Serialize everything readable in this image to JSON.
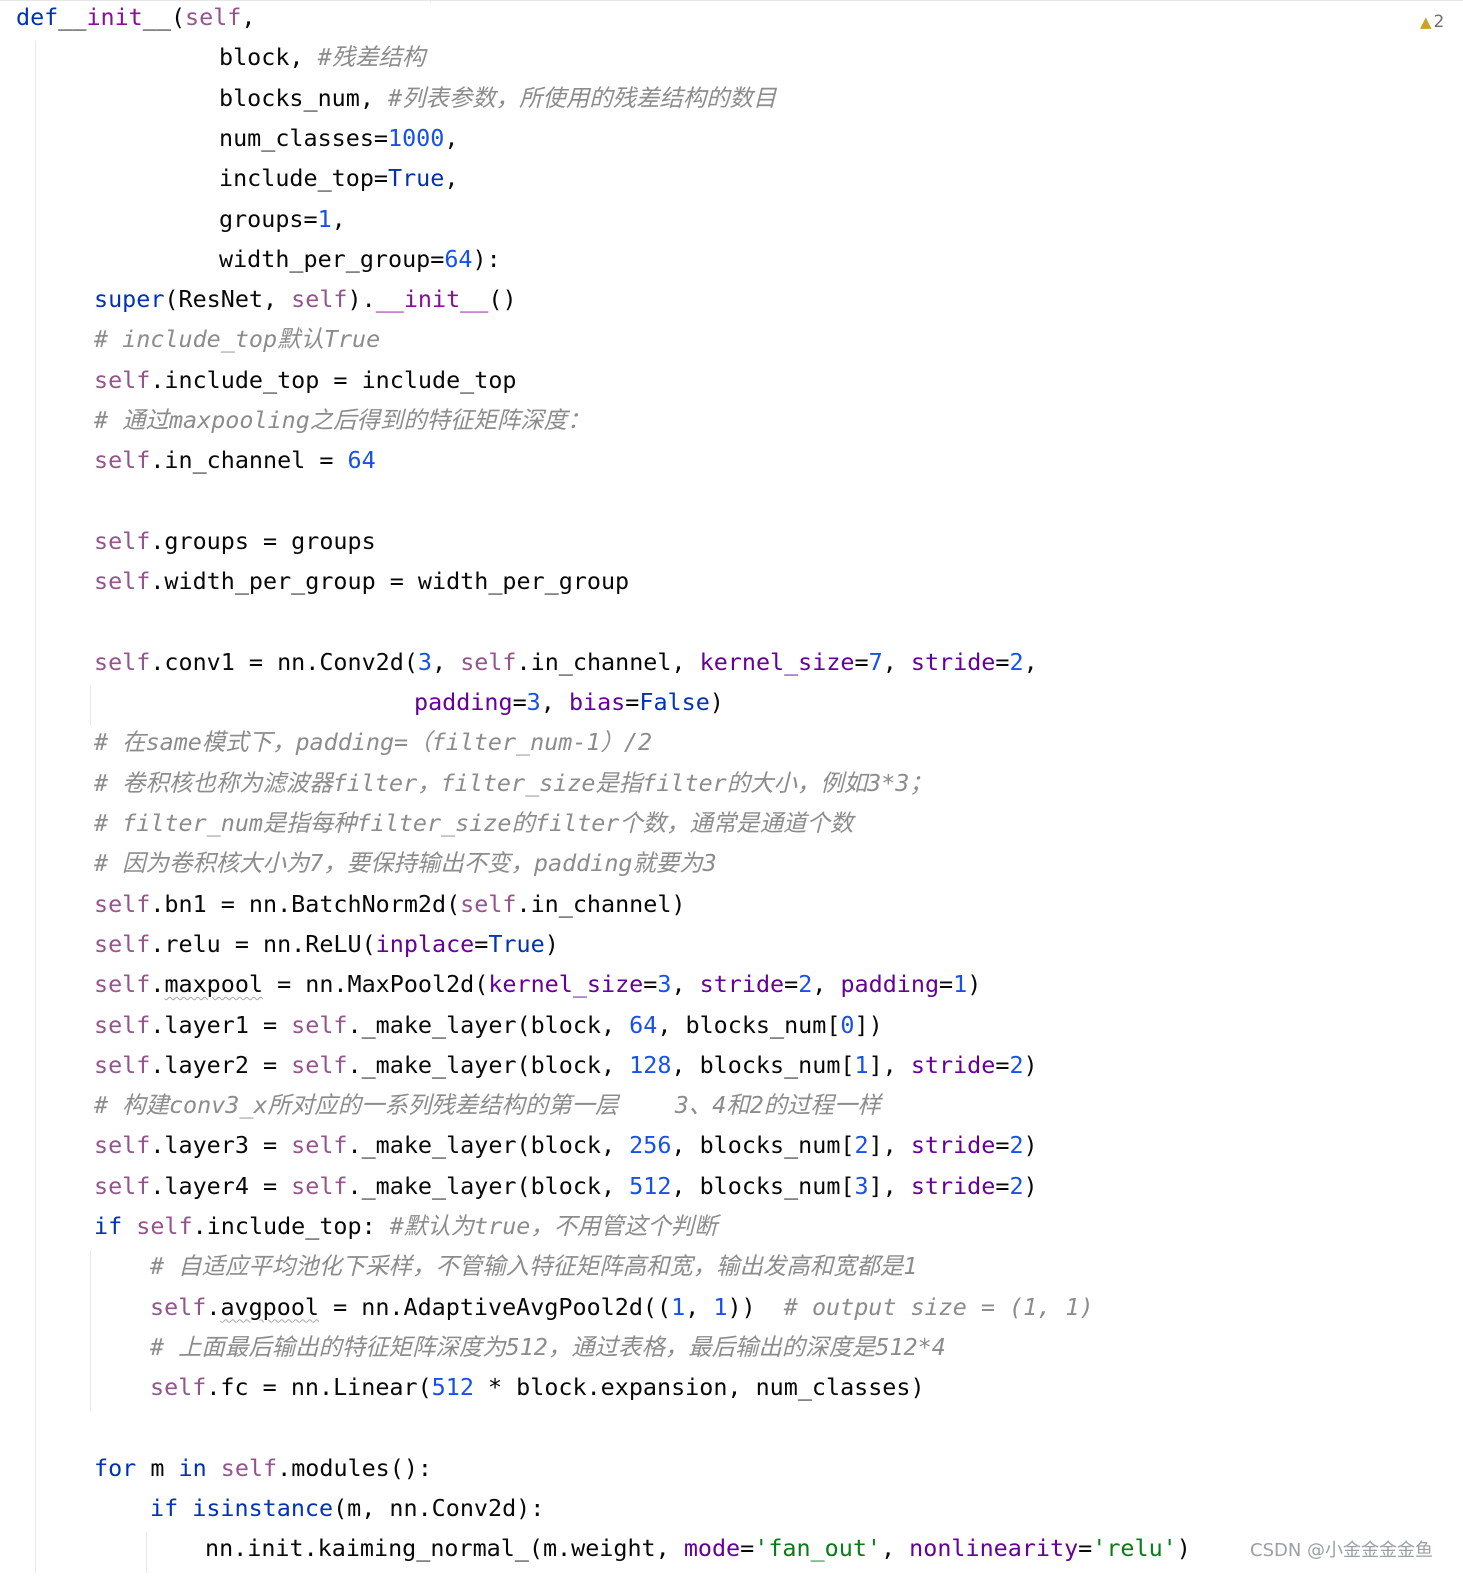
{
  "editor": {
    "language": "python",
    "colors": {
      "keyword": "#0033b3",
      "function": "#871094",
      "self": "#94558d",
      "number": "#1750eb",
      "parameter": "#660099",
      "string": "#067d17",
      "comment": "#8c8c8c",
      "default": "#080808"
    },
    "lines": [
      {
        "indent": 16,
        "tokens": [
          [
            "kw",
            "def"
          ],
          [
            "",
            "_"
          ],
          [
            "",
            "_"
          ],
          [
            "fn",
            "init"
          ],
          [
            "",
            "__("
          ],
          [
            "sf",
            "self"
          ],
          [
            "",
            ","
          ]
        ]
      },
      {
        "indent": 219,
        "tokens": [
          [
            "",
            "block,"
          ],
          [
            "",
            " "
          ],
          [
            "cm",
            "#残差结构"
          ]
        ]
      },
      {
        "indent": 219,
        "tokens": [
          [
            "",
            "blocks_num,"
          ],
          [
            "",
            " "
          ],
          [
            "cm",
            "#列表参数，所使用的残差结构的数目"
          ]
        ]
      },
      {
        "indent": 219,
        "tokens": [
          [
            "",
            "num_classes="
          ],
          [
            "nm",
            "1000"
          ],
          [
            "",
            ","
          ]
        ]
      },
      {
        "indent": 219,
        "tokens": [
          [
            "",
            "include_top="
          ],
          [
            "kw",
            "True"
          ],
          [
            "",
            ","
          ]
        ]
      },
      {
        "indent": 219,
        "tokens": [
          [
            "",
            "groups="
          ],
          [
            "nm",
            "1"
          ],
          [
            "",
            ","
          ]
        ]
      },
      {
        "indent": 219,
        "tokens": [
          [
            "",
            "width_per_group="
          ],
          [
            "nm",
            "64"
          ],
          [
            "",
            "):"
          ]
        ]
      },
      {
        "indent": 94,
        "tokens": [
          [
            "kw",
            "super"
          ],
          [
            "",
            "(ResNet, "
          ],
          [
            "sf",
            "self"
          ],
          [
            "",
            ")."
          ],
          [
            "fn",
            "__init__"
          ],
          [
            "",
            "()"
          ]
        ]
      },
      {
        "indent": 94,
        "tokens": [
          [
            "cm",
            "# include_top默认True"
          ]
        ]
      },
      {
        "indent": 94,
        "tokens": [
          [
            "sf",
            "self"
          ],
          [
            "",
            ".include_top = include_top"
          ]
        ]
      },
      {
        "indent": 94,
        "tokens": [
          [
            "cm",
            "# 通过maxpooling之后得到的特征矩阵深度："
          ]
        ]
      },
      {
        "indent": 94,
        "tokens": [
          [
            "sf",
            "self"
          ],
          [
            "",
            ".in_channel = "
          ],
          [
            "nm",
            "64"
          ]
        ]
      },
      {
        "indent": 94,
        "tokens": []
      },
      {
        "indent": 94,
        "tokens": [
          [
            "sf",
            "self"
          ],
          [
            "",
            ".groups = groups"
          ]
        ]
      },
      {
        "indent": 94,
        "tokens": [
          [
            "sf",
            "self"
          ],
          [
            "",
            ".width_per_group = width_per_group"
          ]
        ]
      },
      {
        "indent": 94,
        "tokens": []
      },
      {
        "indent": 94,
        "tokens": [
          [
            "sf",
            "self"
          ],
          [
            "",
            ".conv1 = nn.Conv2d("
          ],
          [
            "nm",
            "3"
          ],
          [
            "",
            ", "
          ],
          [
            "sf",
            "self"
          ],
          [
            "",
            ".in_channel, "
          ],
          [
            "pr",
            "kernel_size"
          ],
          [
            "",
            "="
          ],
          [
            "nm",
            "7"
          ],
          [
            "",
            ", "
          ],
          [
            "pr",
            "stride"
          ],
          [
            "",
            "="
          ],
          [
            "nm",
            "2"
          ],
          [
            "",
            ","
          ]
        ]
      },
      {
        "indent": 414,
        "tokens": [
          [
            "pr",
            "padding"
          ],
          [
            "",
            "="
          ],
          [
            "nm",
            "3"
          ],
          [
            "",
            ", "
          ],
          [
            "pr",
            "bias"
          ],
          [
            "",
            "="
          ],
          [
            "kw",
            "False"
          ],
          [
            "",
            ")"
          ]
        ]
      },
      {
        "indent": 94,
        "tokens": [
          [
            "cm",
            "# 在same模式下，padding=（filter_num-1）/2"
          ]
        ]
      },
      {
        "indent": 94,
        "tokens": [
          [
            "cm",
            "# 卷积核也称为滤波器filter，filter_size是指filter的大小，例如3*3；"
          ]
        ]
      },
      {
        "indent": 94,
        "tokens": [
          [
            "cm",
            "# filter_num是指每种filter_size的filter个数，通常是通道个数"
          ]
        ]
      },
      {
        "indent": 94,
        "tokens": [
          [
            "cm",
            "# 因为卷积核大小为7，要保持输出不变，padding就要为3"
          ]
        ]
      },
      {
        "indent": 94,
        "tokens": [
          [
            "sf",
            "self"
          ],
          [
            "",
            ".bn1 = nn.BatchNorm2d("
          ],
          [
            "sf",
            "self"
          ],
          [
            "",
            ".in_channel)"
          ]
        ]
      },
      {
        "indent": 94,
        "tokens": [
          [
            "sf",
            "self"
          ],
          [
            "",
            ".relu = nn.ReLU("
          ],
          [
            "pr",
            "inplace"
          ],
          [
            "",
            "="
          ],
          [
            "kw",
            "True"
          ],
          [
            "",
            ")"
          ]
        ]
      },
      {
        "indent": 94,
        "tokens": [
          [
            "sf",
            "self"
          ],
          [
            "",
            "."
          ],
          [
            "",
            "maxpool"
          ],
          [
            "",
            " = nn.MaxPool2d("
          ],
          [
            "pr",
            "kernel_size"
          ],
          [
            "",
            "="
          ],
          [
            "nm",
            "3"
          ],
          [
            "",
            ", "
          ],
          [
            "pr",
            "stride"
          ],
          [
            "",
            "="
          ],
          [
            "nm",
            "2"
          ],
          [
            "",
            ", "
          ],
          [
            "pr",
            "padding"
          ],
          [
            "",
            "="
          ],
          [
            "nm",
            "1"
          ],
          [
            "",
            ")"
          ]
        ]
      },
      {
        "indent": 94,
        "tokens": [
          [
            "sf",
            "self"
          ],
          [
            "",
            ".layer1 = "
          ],
          [
            "sf",
            "self"
          ],
          [
            "",
            "._make_layer(block, "
          ],
          [
            "nm",
            "64"
          ],
          [
            "",
            ", blocks_num["
          ],
          [
            "nm",
            "0"
          ],
          [
            "",
            "])"
          ]
        ]
      },
      {
        "indent": 94,
        "tokens": [
          [
            "sf",
            "self"
          ],
          [
            "",
            ".layer2 = "
          ],
          [
            "sf",
            "self"
          ],
          [
            "",
            "._make_layer(block, "
          ],
          [
            "nm",
            "128"
          ],
          [
            "",
            ", blocks_num["
          ],
          [
            "nm",
            "1"
          ],
          [
            "",
            "], "
          ],
          [
            "pr",
            "stride"
          ],
          [
            "",
            "="
          ],
          [
            "nm",
            "2"
          ],
          [
            "",
            ")"
          ]
        ]
      },
      {
        "indent": 94,
        "tokens": [
          [
            "cm",
            "# 构建conv3_x所对应的一系列残差结构的第一层    3、4和2的过程一样"
          ]
        ]
      },
      {
        "indent": 94,
        "tokens": [
          [
            "sf",
            "self"
          ],
          [
            "",
            ".layer3 = "
          ],
          [
            "sf",
            "self"
          ],
          [
            "",
            "._make_layer(block, "
          ],
          [
            "nm",
            "256"
          ],
          [
            "",
            ", blocks_num["
          ],
          [
            "nm",
            "2"
          ],
          [
            "",
            "], "
          ],
          [
            "pr",
            "stride"
          ],
          [
            "",
            "="
          ],
          [
            "nm",
            "2"
          ],
          [
            "",
            ")"
          ]
        ]
      },
      {
        "indent": 94,
        "tokens": [
          [
            "sf",
            "self"
          ],
          [
            "",
            ".layer4 = "
          ],
          [
            "sf",
            "self"
          ],
          [
            "",
            "._make_layer(block, "
          ],
          [
            "nm",
            "512"
          ],
          [
            "",
            ", blocks_num["
          ],
          [
            "nm",
            "3"
          ],
          [
            "",
            "], "
          ],
          [
            "pr",
            "stride"
          ],
          [
            "",
            "="
          ],
          [
            "nm",
            "2"
          ],
          [
            "",
            ")"
          ]
        ]
      },
      {
        "indent": 94,
        "tokens": [
          [
            "kw",
            "if"
          ],
          [
            "",
            " "
          ],
          [
            "sf",
            "self"
          ],
          [
            "",
            ".include_top:"
          ],
          [
            "",
            " "
          ],
          [
            "cm",
            "#默认为true，不用管这个判断"
          ]
        ]
      },
      {
        "indent": 150,
        "tokens": [
          [
            "cm",
            "# 自适应平均池化下采样，不管输入特征矩阵高和宽，输出发高和宽都是1"
          ]
        ]
      },
      {
        "indent": 150,
        "tokens": [
          [
            "sf",
            "self"
          ],
          [
            "",
            "."
          ],
          [
            "",
            "avgpool"
          ],
          [
            "",
            " = nn.AdaptiveAvgPool2d(("
          ],
          [
            "nm",
            "1"
          ],
          [
            "",
            ", "
          ],
          [
            "nm",
            "1"
          ],
          [
            "",
            "))  "
          ],
          [
            "cm",
            "# output size = (1, 1)"
          ]
        ]
      },
      {
        "indent": 150,
        "tokens": [
          [
            "cm",
            "# 上面最后输出的特征矩阵深度为512，通过表格，最后输出的深度是512*4"
          ]
        ]
      },
      {
        "indent": 150,
        "tokens": [
          [
            "sf",
            "self"
          ],
          [
            "",
            ".fc = nn.Linear("
          ],
          [
            "nm",
            "512"
          ],
          [
            "",
            " * block.expansion, num_classes)"
          ]
        ]
      },
      {
        "indent": 94,
        "tokens": []
      },
      {
        "indent": 94,
        "tokens": [
          [
            "kw",
            "for"
          ],
          [
            "",
            " m "
          ],
          [
            "kw",
            "in"
          ],
          [
            "",
            " "
          ],
          [
            "sf",
            "self"
          ],
          [
            "",
            ".modules():"
          ]
        ]
      },
      {
        "indent": 150,
        "tokens": [
          [
            "kw",
            "if"
          ],
          [
            "",
            " "
          ],
          [
            "kw",
            "isinstance"
          ],
          [
            "",
            "(m, nn.Conv2d):"
          ]
        ]
      },
      {
        "indent": 205,
        "tokens": [
          [
            "",
            "nn.init.kaiming_normal_(m.weight, "
          ],
          [
            "pr",
            "mode"
          ],
          [
            "",
            "="
          ],
          [
            "st",
            "'fan_out'"
          ],
          [
            "",
            ", "
          ],
          [
            "pr",
            "nonlinearity"
          ],
          [
            "",
            "="
          ],
          [
            "st",
            "'relu'"
          ],
          [
            "",
            ")"
          ]
        ]
      }
    ]
  },
  "gutter": {
    "warning_count": "2",
    "warning_icon": "warning-triangle-icon"
  },
  "watermark": "CSDN @小金金金金鱼"
}
